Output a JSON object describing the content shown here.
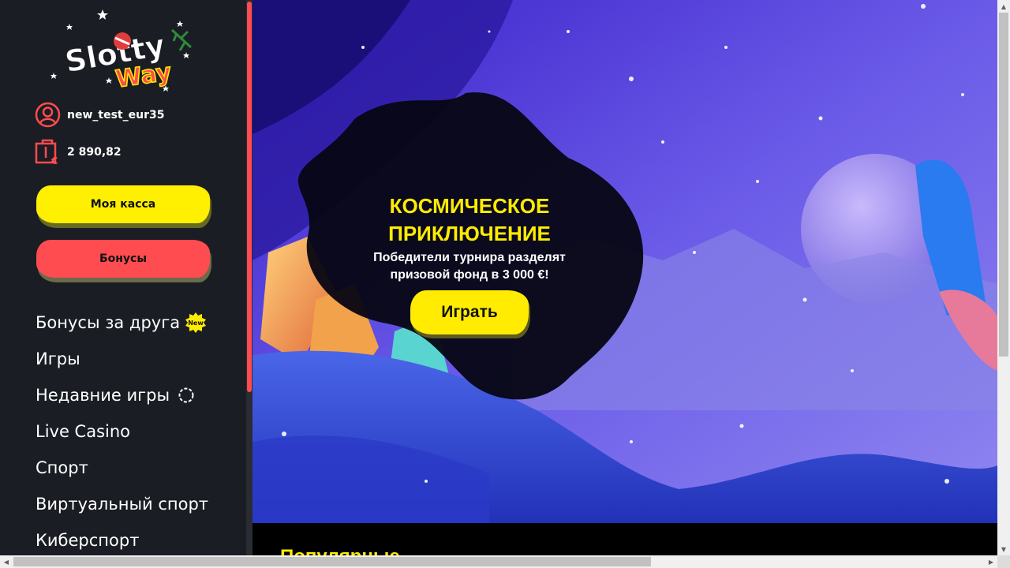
{
  "brand": {
    "logo_line1": "Slotty",
    "logo_line2": "Way"
  },
  "user": {
    "username": "new_test_eur35",
    "balance": "2 890,82"
  },
  "buttons": {
    "cash_label": "Моя касса",
    "bonus_label": "Бонусы"
  },
  "nav": {
    "items": [
      {
        "label": "Бонусы за друга",
        "badge": "New"
      },
      {
        "label": "Игры"
      },
      {
        "label": "Недавние игры"
      },
      {
        "label": "Live Casino"
      },
      {
        "label": "Спорт"
      },
      {
        "label": "Виртуальный спорт"
      },
      {
        "label": "Киберспорт"
      }
    ]
  },
  "banner": {
    "title_line1": "КОСМИЧЕСКОЕ",
    "title_line2": "ПРИКЛЮЧЕНИЕ",
    "subtitle_line1": "Победители турнира разделят",
    "subtitle_line2": "призовой фонд в 3 000 €!",
    "play_label": "Играть"
  },
  "section": {
    "title": "Популярные"
  },
  "colors": {
    "accent_yellow": "#ffec00",
    "accent_red": "#ff4c50",
    "sidebar_bg": "#1b1d24"
  }
}
